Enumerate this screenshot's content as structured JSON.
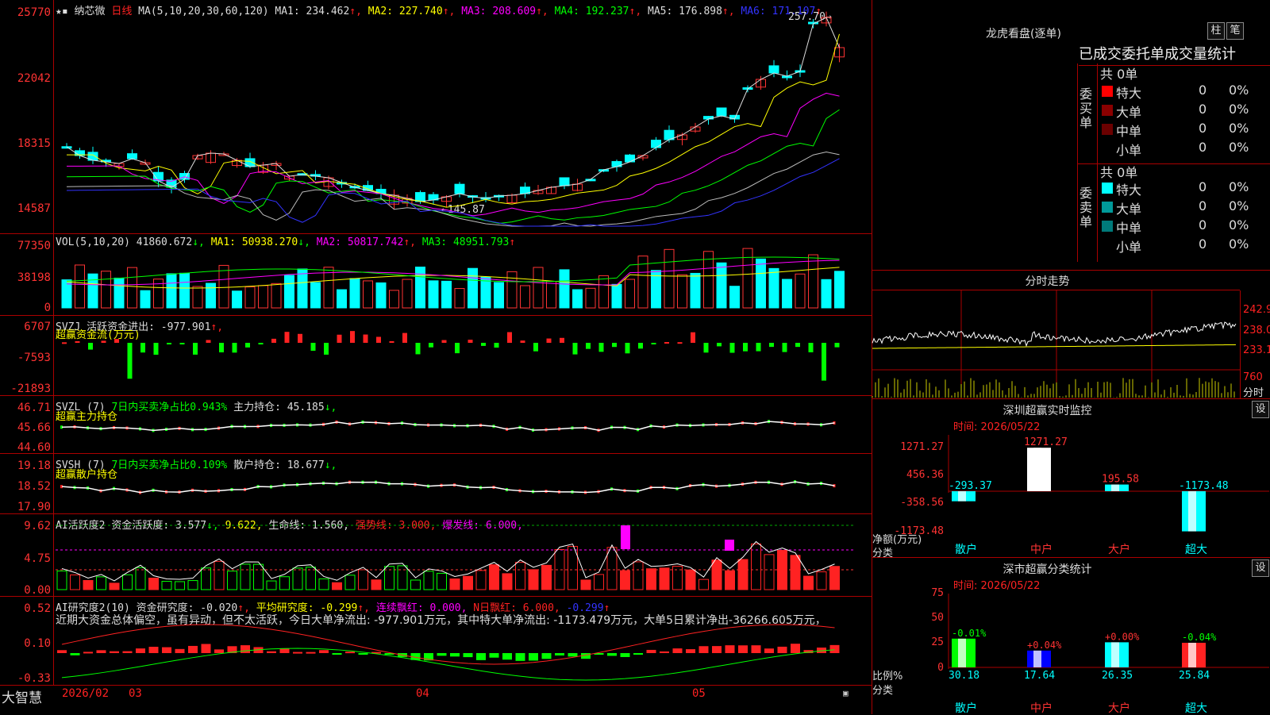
{
  "kline": {
    "yticks": [
      "25770",
      "22042",
      "18315",
      "14587"
    ],
    "indicator": {
      "name": "纳芯微",
      "period": "日线",
      "ma_label": "MA(5,10,20,30,60,120)",
      "ma1": "MA1: 234.462",
      "ma2": "MA2: 227.740",
      "ma3": "MA3: 208.609",
      "ma4": "MA4: 192.237",
      "ma5": "MA5: 176.898",
      "ma6": "MA6: 171.107"
    },
    "high_label": "257.70",
    "low_label": "145.87"
  },
  "vol": {
    "yticks": [
      "77350",
      "38198",
      "0"
    ],
    "label": "VOL(5,10,20)",
    "value": "41860.672",
    "ma1": "MA1: 50938.270",
    "ma2": "MA2: 50817.742",
    "ma3": "MA3: 48951.793"
  },
  "svzj": {
    "yticks": [
      "6707",
      "-7593",
      "-21893"
    ],
    "label": "SVZJ",
    "text": "活跃资金进出: -977.901",
    "sub": "超赢资金流(万元)"
  },
  "svzl": {
    "yticks": [
      "46.71",
      "45.66",
      "44.60"
    ],
    "label": "SVZL (7)",
    "pct": "7日内买卖净占比0.943%",
    "hold": "主力持仓: 45.185",
    "sub": "超赢主力持仓"
  },
  "svsh": {
    "yticks": [
      "19.18",
      "18.52",
      "17.90"
    ],
    "label": "SVSH (7)",
    "pct": "7日内买卖净占比0.109%",
    "hold": "散户持仓: 18.677",
    "sub": "超赢散户持仓"
  },
  "ai1": {
    "yticks": [
      "9.62",
      "4.75",
      "0.00"
    ],
    "label": "AI活跃度2",
    "active": "资金活跃度: 3.577",
    "v2": "9.622,",
    "life": "生命线: 1.560,",
    "strong": "强势线: 3.000,",
    "burst": "爆发线: 6.000,"
  },
  "ai2": {
    "yticks": [
      "0.52",
      "0.10",
      "-0.33"
    ],
    "label": "AI研究度2(10)",
    "research": "资金研究度: -0.020",
    "avg": "平均研究度: -0.299",
    "cont": "连续飘红: 0.000,",
    "nday": "N日飘红: 6.000,",
    "last": "-0.299",
    "comment": "近期大资金总体偏空，虽有异动，但不太活跃，今日大单净流出: -977.901万元，其中特大单净流出: -1173.479万元，大单5日累计净出-36266.605万元，"
  },
  "dateaxis": {
    "brand": "大智慧",
    "labels": [
      "2026/02",
      "03",
      "04",
      "05"
    ]
  },
  "lhkp": {
    "title": "龙虎看盘(逐单)",
    "btn1": "柱",
    "btn2": "笔",
    "header": "已成交委托单成交量统计",
    "buy_side": "委买单",
    "sell_side": "委卖单",
    "buy_total": "共 0单",
    "sell_total": "共 0单",
    "buy_rows": [
      {
        "label": "特大",
        "n": "0",
        "p": "0%"
      },
      {
        "label": "大单",
        "n": "0",
        "p": "0%"
      },
      {
        "label": "中单",
        "n": "0",
        "p": "0%"
      },
      {
        "label": "小单",
        "n": "0",
        "p": "0%"
      }
    ],
    "sell_rows": [
      {
        "label": "特大",
        "n": "0",
        "p": "0%"
      },
      {
        "label": "大单",
        "n": "0",
        "p": "0%"
      },
      {
        "label": "中单",
        "n": "0",
        "p": "0%"
      },
      {
        "label": "小单",
        "n": "0",
        "p": "0%"
      }
    ],
    "colors": {
      "buy": [
        "#ff0000",
        "#8b0000",
        "#6b0000"
      ],
      "sell": [
        "#00ffff",
        "#009a9a",
        "#007a7a"
      ]
    }
  },
  "fenshi": {
    "title": "分时走势",
    "y": [
      "242.9",
      "238.0",
      "233.1",
      "760"
    ],
    "unit": "分时"
  },
  "szjk": {
    "title": "深圳超赢实时监控",
    "set": "设",
    "time": "时间: 2026/05/22",
    "yticks": [
      "1271.27",
      "456.36",
      "-358.56",
      "-1173.48"
    ],
    "ylabel": "净额(万元)",
    "xlabel": "分类",
    "categories": [
      "散户",
      "中户",
      "大户",
      "超大"
    ],
    "values": [
      -293.37,
      1271.27,
      195.58,
      -1173.48
    ],
    "value_labels": [
      "-293.37",
      "1271.27",
      "195.58",
      "-1173.48"
    ]
  },
  "sstj": {
    "title": "深市超赢分类统计",
    "set": "设",
    "time": "时间: 2026/05/22",
    "yticks": [
      "75",
      "50",
      "25",
      "0"
    ],
    "ylabel": "比例%",
    "xlabel": "分类",
    "categories": [
      "散户",
      "中户",
      "大户",
      "超大"
    ],
    "values": [
      30.18,
      17.64,
      26.35,
      25.84
    ],
    "value_labels": [
      "30.18",
      "17.64",
      "26.35",
      "25.84"
    ],
    "change_labels": [
      "-0.01%",
      "+0.04%",
      "+0.00%",
      "-0.04%"
    ]
  }
}
